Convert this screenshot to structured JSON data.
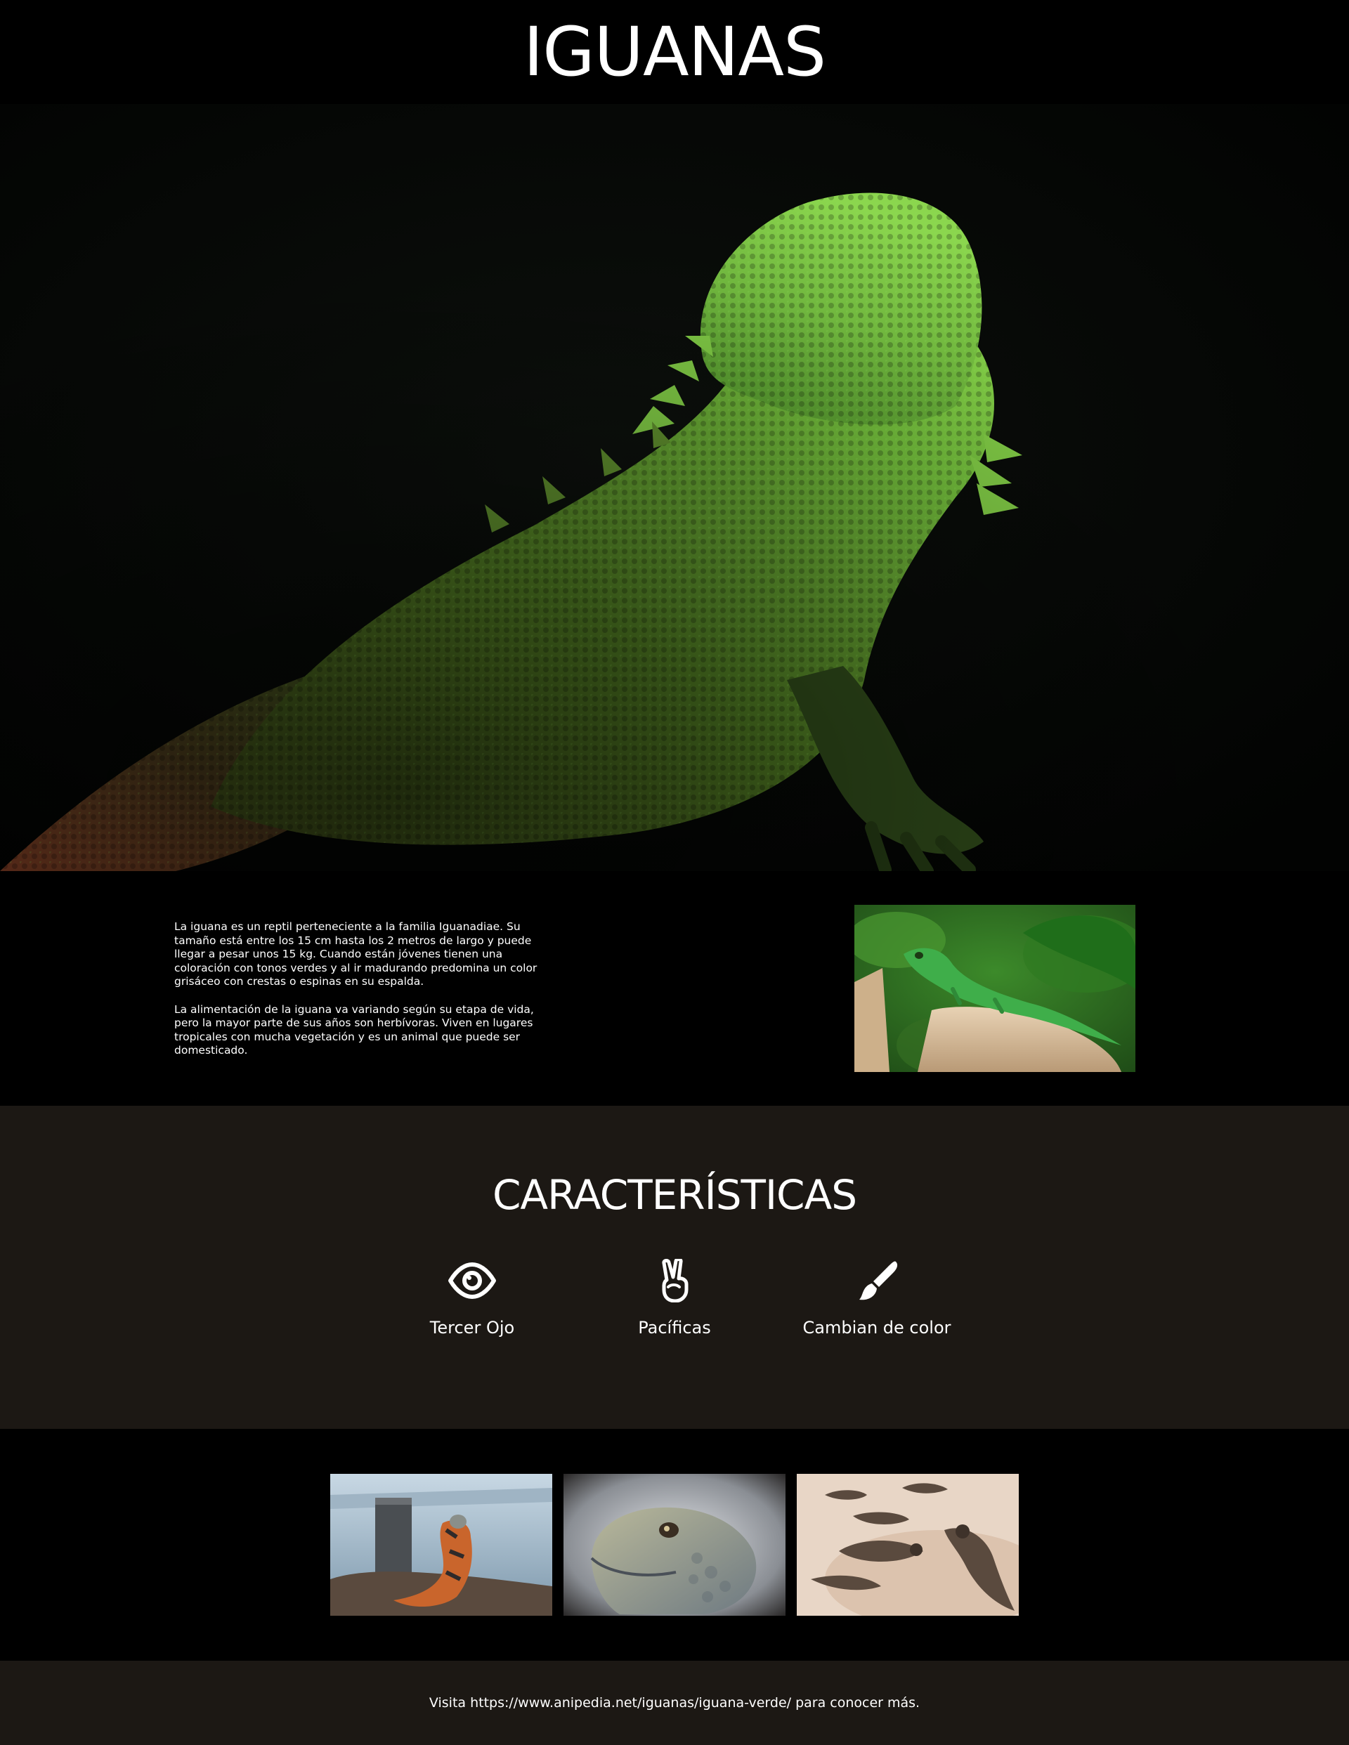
{
  "header": {
    "title": "IGUANAS"
  },
  "hero": {
    "image": "green-iguana-hero-photo"
  },
  "intro": {
    "paragraphs": [
      "La iguana es un reptil perteneciente a la familia Iguanadiae. Su tamaño está entre los 15 cm hasta los 2 metros de largo y puede llegar a pesar unos 15 kg. Cuando están jóvenes tienen una coloración con tonos verdes y al ir madurando predomina un color grisáceo con crestas o espinas en su espalda.",
      "La alimentación de la iguana va variando según su etapa de vida, pero la mayor parte de sus años son herbívoras. Viven en lugares tropicales con mucha vegetación y es un animal que puede ser domesticado."
    ],
    "image": "green-lizard-on-stump-photo"
  },
  "features": {
    "title": "CARACTERÍSTICAS",
    "items": [
      {
        "icon": "eye-icon",
        "label": "Tercer Ojo"
      },
      {
        "icon": "peace-hand-icon",
        "label": "Pacíficas"
      },
      {
        "icon": "paint-brush-icon",
        "label": "Cambian de color"
      }
    ]
  },
  "gallery": {
    "images": [
      "iguana-by-sea-photo",
      "iguana-head-closeup-photo",
      "iguanas-on-sand-photo"
    ]
  },
  "footer": {
    "text": "Visita https://www.anipedia.net/iguanas/iguana-verde/ para conocer más."
  },
  "colors": {
    "background": "#000000",
    "section_alt": "#1c1814",
    "text": "#ffffff",
    "iguana_green": "#5fb83a"
  }
}
